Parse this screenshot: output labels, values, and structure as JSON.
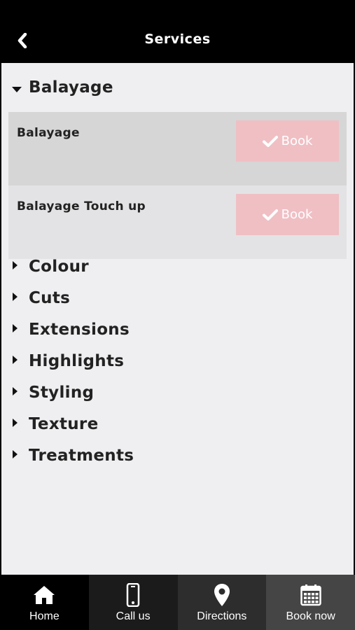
{
  "header": {
    "title": "Services",
    "back_icon": "chevron-left-icon"
  },
  "categories": [
    {
      "label": "Balayage",
      "expanded": true
    },
    {
      "label": "Colour",
      "expanded": false
    },
    {
      "label": "Cuts",
      "expanded": false
    },
    {
      "label": "Extensions",
      "expanded": false
    },
    {
      "label": "Highlights",
      "expanded": false
    },
    {
      "label": "Styling",
      "expanded": false
    },
    {
      "label": "Texture",
      "expanded": false
    },
    {
      "label": "Treatments",
      "expanded": false
    }
  ],
  "services": [
    {
      "name": "Balayage",
      "book_label": "Book",
      "selected": true
    },
    {
      "name": "Balayage Touch up",
      "book_label": "Book",
      "selected": false
    }
  ],
  "bottom_nav": [
    {
      "label": "Home",
      "icon": "home-icon"
    },
    {
      "label": "Call us",
      "icon": "phone-icon"
    },
    {
      "label": "Directions",
      "icon": "map-pin-icon"
    },
    {
      "label": "Book now",
      "icon": "calendar-icon"
    }
  ],
  "colors": {
    "header_bg": "#000000",
    "content_bg": "#efeff1",
    "book_button": "#efbfc4",
    "selected_row": "#d6d6d6"
  }
}
